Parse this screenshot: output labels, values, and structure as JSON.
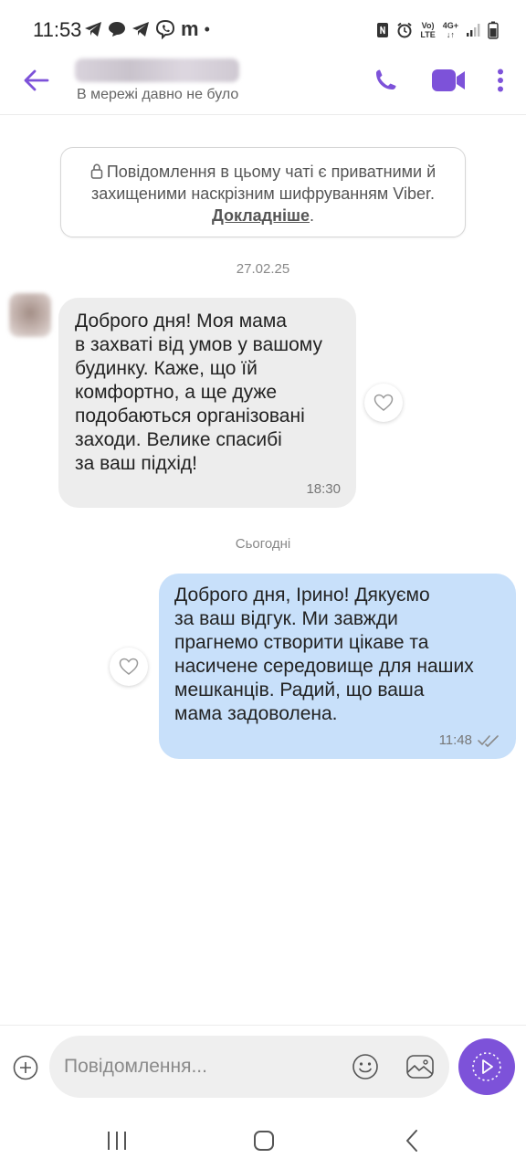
{
  "status_bar": {
    "time": "11:53",
    "icons": [
      "telegram-icon",
      "chat-bubble-icon",
      "telegram-icon",
      "viber-icon",
      "messenger-m",
      "dot"
    ],
    "messenger_label": "m",
    "dot": "•",
    "right_icons": [
      "nfc-icon",
      "alarm-icon",
      "volte-icon",
      "4g-icon",
      "signal-icon",
      "battery-icon"
    ],
    "volte_top": "Vo)",
    "volte_bottom": "LTE",
    "net_top": "4G+",
    "net_bottom": "↓↑"
  },
  "header": {
    "contact_status": "В мережі давно не було"
  },
  "encryption_notice": {
    "text": "Повідомлення в цьому чаті є приватними й захищеними наскрізним шифруванням Viber.",
    "link": "Докладніше",
    "suffix": "."
  },
  "date_separators": {
    "first": "27.02.25",
    "second": "Сьогодні"
  },
  "messages": [
    {
      "direction": "incoming",
      "lines": [
        "Доброго дня! Моя мама",
        "в захваті від умов у вашому",
        "будинку. Каже, що їй",
        "комфортно, а ще дуже",
        "подобаються організовані",
        "заходи. Велике спасибі",
        "за ваш підхід!"
      ],
      "time": "18:30"
    },
    {
      "direction": "outgoing",
      "lines": [
        "Доброго дня, Ірино! Дякуємо",
        "за ваш відгук. Ми завжди",
        "прагнемо створити цікаве та",
        "насичене середовище для наших",
        "мешканців. Радий,  що ваша",
        "мама задоволена."
      ],
      "time": "11:48",
      "status": "read"
    }
  ],
  "input": {
    "placeholder": "Повідомлення..."
  },
  "colors": {
    "accent": "#7d52d9",
    "incoming_bubble": "#ededed",
    "outgoing_bubble": "#c8e0fa"
  }
}
